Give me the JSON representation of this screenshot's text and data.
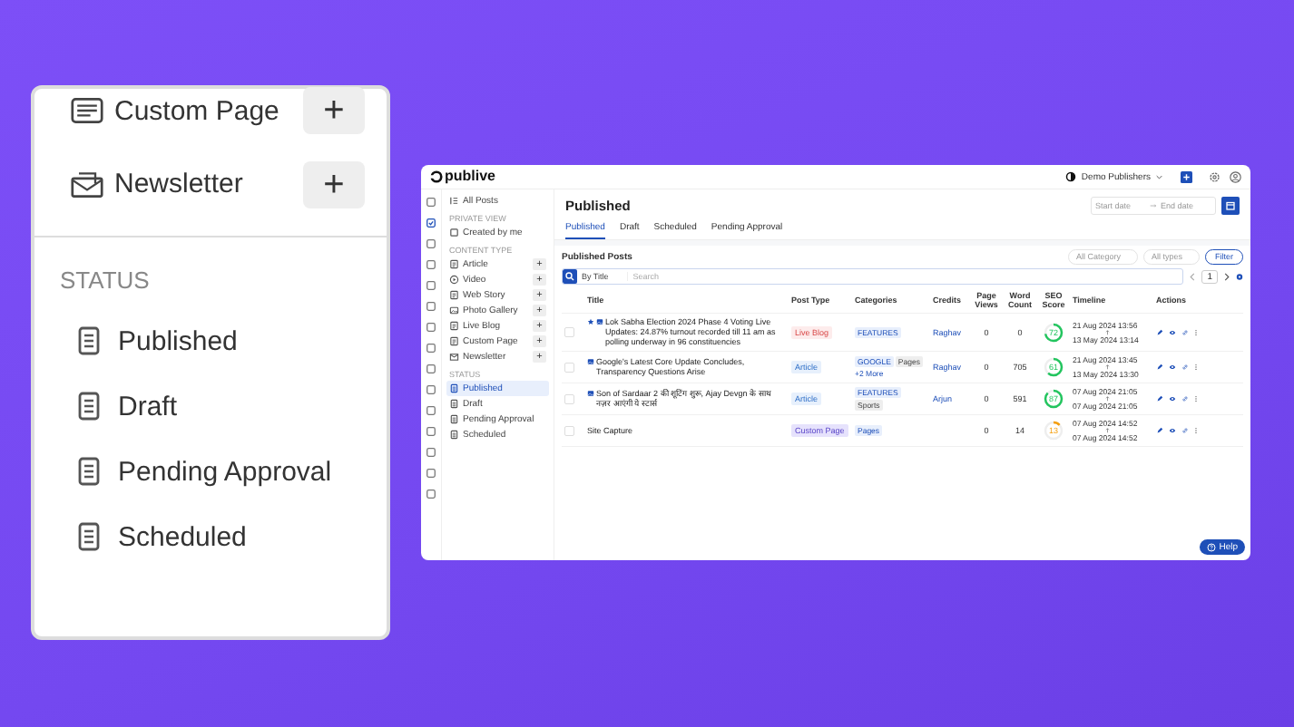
{
  "callout": {
    "content_types": [
      {
        "label": "Custom Page",
        "kind": "page",
        "action": "+"
      },
      {
        "label": "Newsletter",
        "kind": "newsletter",
        "action": "+"
      }
    ],
    "status_heading": "STATUS",
    "statuses": [
      "Published",
      "Draft",
      "Pending Approval",
      "Scheduled"
    ]
  },
  "app": {
    "logo": "publive",
    "workspace": "Demo Publishers",
    "rail_icons": [
      {
        "selected": false
      },
      {
        "selected": true
      },
      {
        "selected": false
      },
      {
        "selected": false
      },
      {
        "selected": false
      },
      {
        "selected": false
      },
      {
        "selected": false
      },
      {
        "selected": false
      },
      {
        "selected": false
      },
      {
        "selected": false
      },
      {
        "selected": false
      },
      {
        "selected": false
      },
      {
        "selected": false
      },
      {
        "selected": false
      },
      {
        "selected": false
      }
    ],
    "sidebar": {
      "all_posts": "All Posts",
      "private_heading": "PRIVATE VIEW",
      "private_items": [
        "Created by me"
      ],
      "content_heading": "CONTENT TYPE",
      "content_types": [
        {
          "label": "Article",
          "kind": "article",
          "action": "+"
        },
        {
          "label": "Video",
          "kind": "video",
          "action": "+"
        },
        {
          "label": "Web Story",
          "kind": "story",
          "action": "+"
        },
        {
          "label": "Photo Gallery",
          "kind": "gallery",
          "action": "+"
        },
        {
          "label": "Live Blog",
          "kind": "live",
          "action": "+"
        },
        {
          "label": "Custom Page",
          "kind": "page",
          "action": "+"
        },
        {
          "label": "Newsletter",
          "kind": "newsletter",
          "action": "+"
        }
      ],
      "status_heading": "STATUS",
      "statuses": [
        {
          "label": "Published",
          "selected": true
        },
        {
          "label": "Draft",
          "selected": false
        },
        {
          "label": "Pending Approval",
          "selected": false
        },
        {
          "label": "Scheduled",
          "selected": false
        }
      ]
    },
    "page_title": "Published",
    "date_range": {
      "start_placeholder": "Start date",
      "end_placeholder": "End date"
    },
    "tabs": [
      {
        "label": "Published",
        "selected": true
      },
      {
        "label": "Draft",
        "selected": false
      },
      {
        "label": "Scheduled",
        "selected": false
      },
      {
        "label": "Pending Approval",
        "selected": false
      }
    ],
    "posts_heading": "Published Posts",
    "category_filter": "All Category",
    "type_filter": "All types",
    "filter_button": "Filter",
    "search": {
      "scope": "By Title",
      "placeholder": "Search"
    },
    "page_number": "1",
    "table": {
      "columns": [
        "Title",
        "Post Type",
        "Categories",
        "Credits",
        "Page Views",
        "Word Count",
        "SEO Score",
        "Timeline",
        "Actions"
      ],
      "rows": [
        {
          "checked": false,
          "featured": true,
          "thumbnail": true,
          "title": "Lok Sabha Election 2024 Phase 4 Voting Live Updates: 24.87% turnout recorded till 11 am as polling underway in 96 constituencies",
          "post_type": {
            "label": "Live Blog",
            "kind": "live"
          },
          "categories": [
            {
              "label": "FEATURES",
              "kind": "primary"
            }
          ],
          "more": "",
          "credits": "Raghav",
          "page_views": "0",
          "word_count": "0",
          "seo": {
            "score": "72",
            "color": "#22c55e"
          },
          "updated": "21 Aug 2024 13:56",
          "created": "13 May 2024 13:14"
        },
        {
          "checked": false,
          "featured": false,
          "thumbnail": true,
          "title": "Google's Latest Core Update Concludes, Transparency Questions Arise",
          "post_type": {
            "label": "Article",
            "kind": "article"
          },
          "categories": [
            {
              "label": "GOOGLE",
              "kind": "primary"
            },
            {
              "label": "Pages",
              "kind": "secondary"
            }
          ],
          "more": "+2 More",
          "credits": "Raghav",
          "page_views": "0",
          "word_count": "705",
          "seo": {
            "score": "61",
            "color": "#22c55e"
          },
          "updated": "21 Aug 2024 13:45",
          "created": "13 May 2024 13:30"
        },
        {
          "checked": false,
          "featured": false,
          "thumbnail": true,
          "title": "Son of Sardaar 2 की शूटिंग शुरू, Ajay Devgn के साथ नज़र आएंगी ये स्टार्स",
          "post_type": {
            "label": "Article",
            "kind": "article"
          },
          "categories": [
            {
              "label": "FEATURES",
              "kind": "primary"
            },
            {
              "label": "Sports",
              "kind": "secondary"
            }
          ],
          "more": "",
          "credits": "Arjun",
          "page_views": "0",
          "word_count": "591",
          "seo": {
            "score": "87",
            "color": "#22c55e"
          },
          "updated": "07 Aug 2024 21:05",
          "created": "07 Aug 2024 21:05"
        },
        {
          "checked": false,
          "featured": false,
          "thumbnail": false,
          "title": "Site Capture",
          "post_type": {
            "label": "Custom Page",
            "kind": "page"
          },
          "categories": [
            {
              "label": "Pages",
              "kind": "primary"
            }
          ],
          "more": "",
          "credits": "",
          "page_views": "0",
          "word_count": "14",
          "seo": {
            "score": "13",
            "color": "#f59e0b"
          },
          "updated": "07 Aug 2024 14:52",
          "created": "07 Aug 2024 14:52"
        }
      ]
    },
    "help_button": "Help"
  }
}
